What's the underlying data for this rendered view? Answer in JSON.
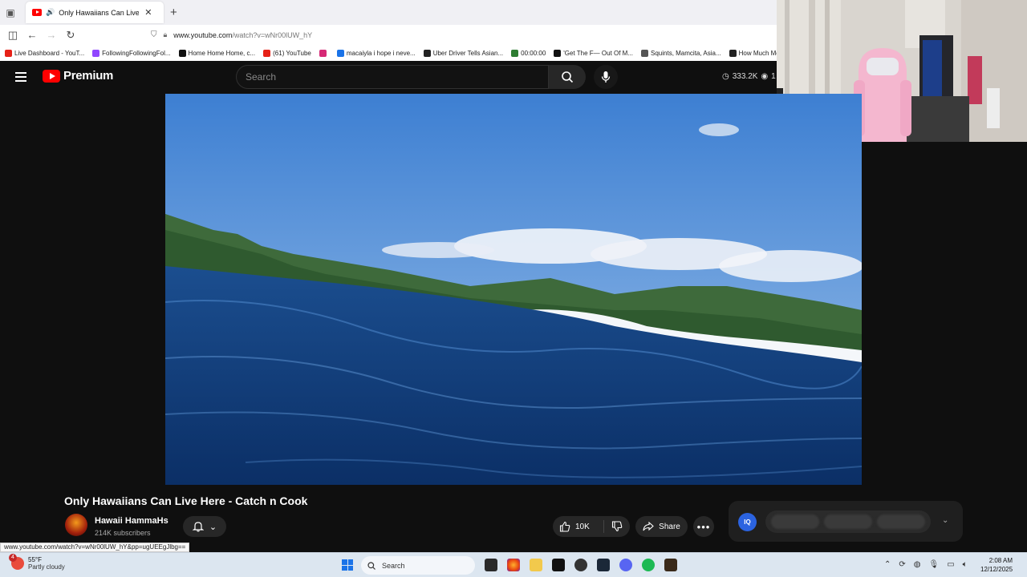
{
  "browser": {
    "tab_title": "Only Hawaiians Can Live Here",
    "new_tab": "+",
    "url_domain": "www.youtube.com",
    "url_path": "/watch?v=wNr00lUW_hY",
    "bookmarks": [
      {
        "label": "Live Dashboard - YouT...",
        "color": "#e62117"
      },
      {
        "label": "FollowingFollowingFol...",
        "color": "#9147ff"
      },
      {
        "label": "Home Home Home, c...",
        "color": "#111111"
      },
      {
        "label": "(61) YouTube",
        "color": "#e62117"
      },
      {
        "label": "",
        "color": "#d62976"
      },
      {
        "label": "macaiyla i hope i neve...",
        "color": "#1a73e8"
      },
      {
        "label": "Uber Driver Tells Asian...",
        "color": "#222222"
      },
      {
        "label": "00:00:00",
        "color": "#2e7d32"
      },
      {
        "label": "'Get The F— Out Of M...",
        "color": "#111111"
      },
      {
        "label": "Squints, Mamcita, Asia...",
        "color": "#555555"
      },
      {
        "label": "How Much Mone",
        "color": "#222222"
      }
    ],
    "status_url": "www.youtube.com/watch?v=wNr00lUW_hY&pp=ugUEEgJlbg=="
  },
  "youtube": {
    "logo_text": "Premium",
    "search_placeholder": "Search",
    "views": "333.2K",
    "views_more": "1"
  },
  "video": {
    "title": "Only Hawaiians Can Live Here - Catch n Cook",
    "channel_name": "Hawaii HammaHs",
    "subscribers": "214K subscribers",
    "likes": "10K",
    "share_label": "Share",
    "more": "•••"
  },
  "side_panel": {
    "badge": "IQ",
    "pills": [
      "",
      "",
      ""
    ]
  },
  "taskbar": {
    "weather_temp": "55°F",
    "weather_desc": "Partly cloudy",
    "weather_badge": "4",
    "search_label": "Search",
    "time": "2:08 AM",
    "date": "12/12/2025"
  }
}
